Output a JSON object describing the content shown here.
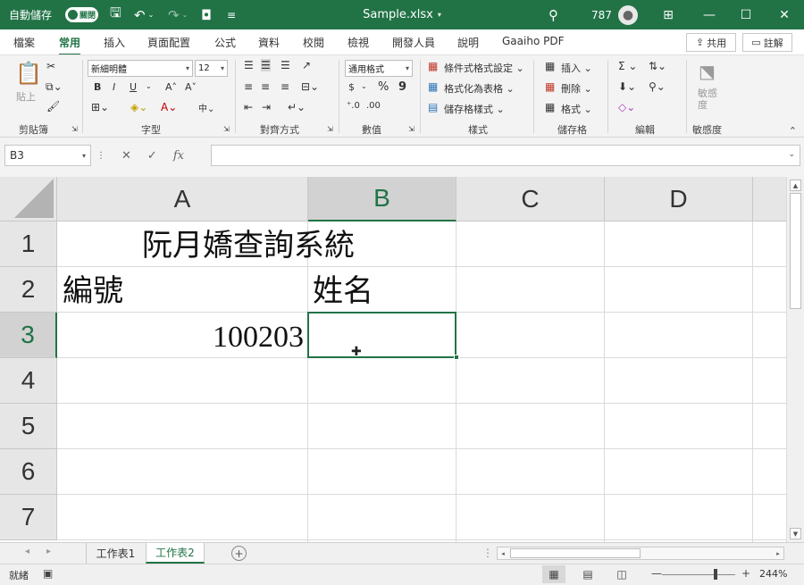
{
  "titlebar": {
    "autosave_label": "自動儲存",
    "autosave_state": "關閉",
    "filename": "Sample.xlsx",
    "count": "787",
    "minimize": "—",
    "maximize": "☐",
    "close": "✕"
  },
  "ribbon_tabs": [
    "檔案",
    "常用",
    "插入",
    "頁面配置",
    "公式",
    "資料",
    "校閱",
    "檢視",
    "開發人員",
    "說明",
    "Gaaiho PDF"
  ],
  "ribbon_actions": {
    "share": "共用",
    "comments": "註解"
  },
  "ribbon": {
    "groups": [
      "剪貼簿",
      "字型",
      "對齊方式",
      "數值",
      "樣式",
      "儲存格",
      "編輯",
      "敏感度"
    ],
    "paste_label": "貼上",
    "font_name": "新細明體",
    "font_size": "12",
    "number_format": "通用格式",
    "conditional_format": "條件式格式設定",
    "format_as_table": "格式化為表格",
    "cell_styles": "儲存格樣式",
    "insert": "插入",
    "delete": "刪除",
    "format": "格式",
    "sensitivity": "敏感度",
    "bold": "B",
    "italic": "I",
    "underline": "U",
    "grow_font": "A˄",
    "shrink_font": "A˅",
    "percent": "%",
    "comma": "9",
    "currency": "$"
  },
  "formula_bar": {
    "name_box": "B3",
    "cancel": "✕",
    "enter": "✓",
    "function": "fx",
    "content": ""
  },
  "grid": {
    "columns": [
      "A",
      "B",
      "C",
      "D"
    ],
    "rows": [
      "1",
      "2",
      "3",
      "4",
      "5",
      "6",
      "7"
    ],
    "selected_cell": "B3",
    "cells": {
      "A1": "阮月嬌查詢系統",
      "A2": "編號",
      "B2": "姓名",
      "A3": "100203"
    }
  },
  "sheets": {
    "tabs": [
      "工作表1",
      "工作表2"
    ],
    "active": "工作表2"
  },
  "statusbar": {
    "mode": "就緒",
    "zoom": "244%",
    "zoom_out": "—",
    "zoom_in": "+"
  },
  "colors": {
    "accent": "#217346",
    "ribbon_bg": "#f3f3f3",
    "header_bg": "#e6e6e6"
  }
}
